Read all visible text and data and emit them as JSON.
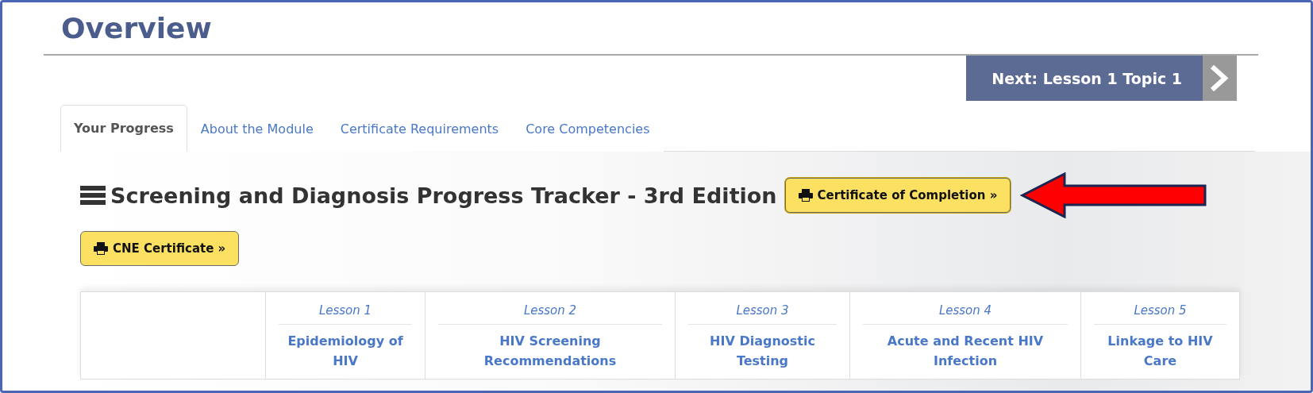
{
  "page_title": "Overview",
  "next_button": {
    "label": "Next: Lesson 1 Topic 1"
  },
  "tabs": [
    {
      "label": "Your Progress",
      "selected": true
    },
    {
      "label": "About the Module",
      "selected": false
    },
    {
      "label": "Certificate Requirements",
      "selected": false
    },
    {
      "label": "Core Competencies",
      "selected": false
    }
  ],
  "tracker": {
    "title": "Screening and Diagnosis Progress Tracker - 3rd Edition",
    "buttons": [
      {
        "label": "Certificate of Completion »",
        "highlighted": true
      },
      {
        "label": "CNE Certificate »",
        "highlighted": false
      }
    ]
  },
  "table": {
    "columns": [
      {
        "lesson": "Lesson 1",
        "title": "Epidemiology of HIV"
      },
      {
        "lesson": "Lesson 2",
        "title": "HIV Screening Recommendations"
      },
      {
        "lesson": "Lesson 3",
        "title": "HIV Diagnostic Testing"
      },
      {
        "lesson": "Lesson 4",
        "title": "Acute and Recent HIV Infection"
      },
      {
        "lesson": "Lesson 5",
        "title": "Linkage to HIV Care"
      }
    ]
  }
}
